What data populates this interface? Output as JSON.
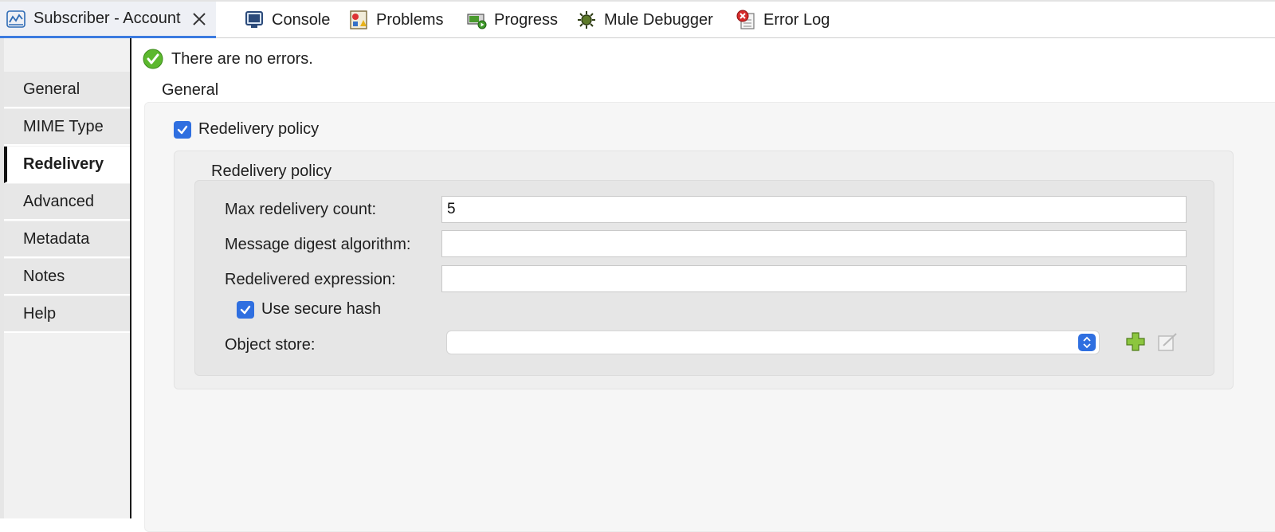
{
  "tabs": [
    {
      "label": "Subscriber - Account",
      "icon": "flow-icon",
      "active": true
    },
    {
      "label": "Console",
      "icon": "console-icon"
    },
    {
      "label": "Problems",
      "icon": "problems-icon"
    },
    {
      "label": "Progress",
      "icon": "progress-icon"
    },
    {
      "label": "Mule Debugger",
      "icon": "debugger-icon"
    },
    {
      "label": "Error Log",
      "icon": "error-log-icon"
    }
  ],
  "nav": {
    "items": [
      {
        "label": "General"
      },
      {
        "label": "MIME Type"
      },
      {
        "label": "Redelivery",
        "active": true
      },
      {
        "label": "Advanced"
      },
      {
        "label": "Metadata"
      },
      {
        "label": "Notes"
      },
      {
        "label": "Help"
      }
    ]
  },
  "status": {
    "message": "There are no errors.",
    "icon": "success-check-icon"
  },
  "general": {
    "section_title": "General",
    "redelivery_checkbox_label": "Redelivery policy",
    "redelivery_checked": true,
    "group_title": "Redelivery policy",
    "fields": {
      "max_redelivery_label": "Max redelivery count:",
      "max_redelivery_value": "5",
      "digest_label": "Message digest algorithm:",
      "digest_value": "",
      "expression_label": "Redelivered expression:",
      "expression_value": "",
      "secure_hash_label": "Use secure hash",
      "secure_hash_checked": true,
      "object_store_label": "Object store:",
      "object_store_value": ""
    }
  },
  "colors": {
    "accent": "#2f6fe0",
    "active_tab_underline": "#3b7be0",
    "success": "#5cb82e",
    "add_button": "#8cc63f"
  }
}
